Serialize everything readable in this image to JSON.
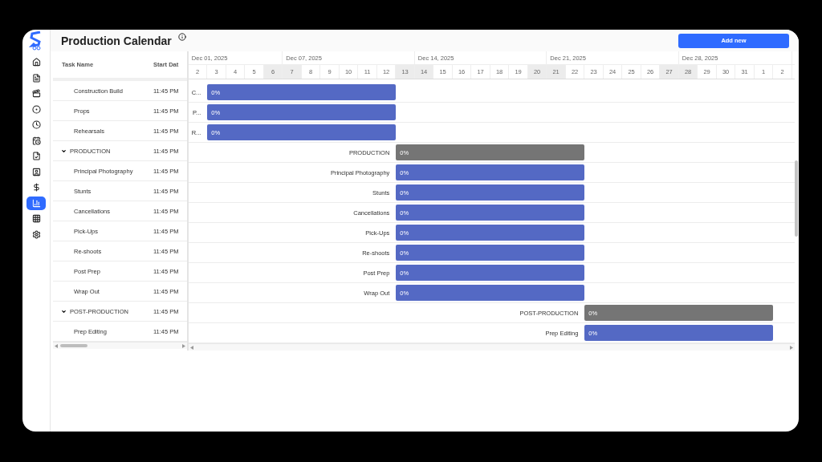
{
  "sidebar": {
    "items": [
      {
        "selected": false
      },
      {
        "selected": false
      },
      {
        "selected": false
      },
      {
        "selected": false
      },
      {
        "selected": false
      },
      {
        "selected": false
      },
      {
        "selected": false
      },
      {
        "selected": false
      },
      {
        "selected": false
      },
      {
        "selected": true
      },
      {
        "selected": false
      },
      {
        "selected": false
      }
    ]
  },
  "header": {
    "title": "Production Calendar",
    "add_button": "Add new"
  },
  "table": {
    "columns": [
      "Task Name",
      "Start Dat"
    ]
  },
  "timeline": {
    "weeks": [
      {
        "label": "Dec 01, 2025",
        "days": [
          {
            "label": "2",
            "weekend": false
          },
          {
            "label": "3",
            "weekend": false
          },
          {
            "label": "4",
            "weekend": false
          },
          {
            "label": "5",
            "weekend": false
          },
          {
            "label": "6",
            "weekend": true
          }
        ]
      },
      {
        "label": "Dec 07, 2025",
        "days": [
          {
            "label": "7",
            "weekend": true
          },
          {
            "label": "8",
            "weekend": false
          },
          {
            "label": "9",
            "weekend": false
          },
          {
            "label": "10",
            "weekend": false
          },
          {
            "label": "11",
            "weekend": false
          },
          {
            "label": "12",
            "weekend": false
          },
          {
            "label": "13",
            "weekend": true
          }
        ]
      },
      {
        "label": "Dec 14, 2025",
        "days": [
          {
            "label": "14",
            "weekend": true
          },
          {
            "label": "15",
            "weekend": false
          },
          {
            "label": "16",
            "weekend": false
          },
          {
            "label": "17",
            "weekend": false
          },
          {
            "label": "18",
            "weekend": false
          },
          {
            "label": "19",
            "weekend": false
          },
          {
            "label": "20",
            "weekend": true
          }
        ]
      },
      {
        "label": "Dec 21, 2025",
        "days": [
          {
            "label": "21",
            "weekend": true
          },
          {
            "label": "22",
            "weekend": false
          },
          {
            "label": "23",
            "weekend": false
          },
          {
            "label": "24",
            "weekend": false
          },
          {
            "label": "25",
            "weekend": false
          },
          {
            "label": "26",
            "weekend": false
          },
          {
            "label": "27",
            "weekend": true
          }
        ]
      },
      {
        "label": "Dec 28, 2025",
        "days": [
          {
            "label": "28",
            "weekend": true
          },
          {
            "label": "29",
            "weekend": false
          },
          {
            "label": "30",
            "weekend": false
          },
          {
            "label": "31",
            "weekend": false
          },
          {
            "label": "1",
            "weekend": false
          },
          {
            "label": "2",
            "weekend": false
          }
        ]
      }
    ]
  },
  "groups": [
    {
      "children": [
        {
          "name": "Construction Build",
          "start": "11:45 PM",
          "bar_label": "C...",
          "progress": "0%"
        },
        {
          "name": "Props",
          "start": "11:45 PM",
          "bar_label": "P...",
          "progress": "0%"
        },
        {
          "name": "Rehearsals",
          "start": "11:45 PM",
          "bar_label": "R...",
          "progress": "0%"
        }
      ]
    },
    {
      "name": "PRODUCTION",
      "expanded": true,
      "start": "11:45 PM",
      "bar_label": "PRODUCTION",
      "progress": "0%",
      "children": [
        {
          "name": "Principal Photography",
          "start": "11:45 PM",
          "bar_label": "Principal Photography",
          "progress": "0%"
        },
        {
          "name": "Stunts",
          "start": "11:45 PM",
          "bar_label": "Stunts",
          "progress": "0%"
        },
        {
          "name": "Cancellations",
          "start": "11:45 PM",
          "bar_label": "Cancellations",
          "progress": "0%"
        },
        {
          "name": "Pick-Ups",
          "start": "11:45 PM",
          "bar_label": "Pick-Ups",
          "progress": "0%"
        },
        {
          "name": "Re-shoots",
          "start": "11:45 PM",
          "bar_label": "Re-shoots",
          "progress": "0%"
        },
        {
          "name": "Post Prep",
          "start": "11:45 PM",
          "bar_label": "Post Prep",
          "progress": "0%"
        },
        {
          "name": "Wrap Out",
          "start": "11:45 PM",
          "bar_label": "Wrap Out",
          "progress": "0%"
        }
      ]
    },
    {
      "name": "POST-PRODUCTION",
      "expanded": true,
      "start": "11:45 PM",
      "bar_label": "POST-PRODUCTION",
      "progress": "0%",
      "children": [
        {
          "name": "Prep Editing",
          "start": "11:45 PM",
          "bar_label": "Prep Editing",
          "progress": "0%"
        }
      ]
    }
  ]
}
